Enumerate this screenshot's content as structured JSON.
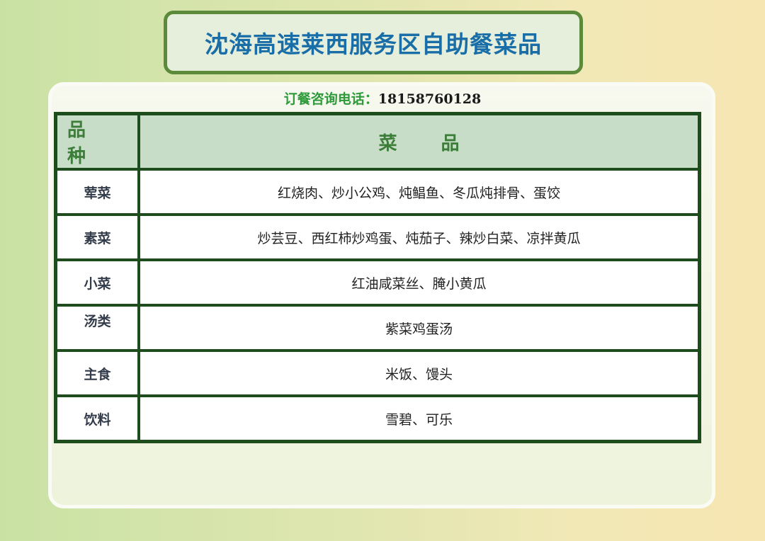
{
  "title": "沈海高速莱西服务区自助餐菜品",
  "phone": {
    "label": "订餐咨询电话：",
    "number": "18158760128"
  },
  "table": {
    "headers": {
      "category": "品种",
      "dishes": "菜品"
    },
    "rows": [
      {
        "category": "荤菜",
        "dishes": "红烧肉、炒小公鸡、炖鲳鱼、冬瓜炖排骨、蛋饺"
      },
      {
        "category": "素菜",
        "dishes": "炒芸豆、西红柿炒鸡蛋、炖茄子、辣炒白菜、凉拌黄瓜"
      },
      {
        "category": "小菜",
        "dishes": "红油咸菜丝、腌小黄瓜"
      },
      {
        "category": "汤类",
        "dishes": "紫菜鸡蛋汤"
      },
      {
        "category": "主食",
        "dishes": "米饭、馒头"
      },
      {
        "category": "饮料",
        "dishes": "雪碧、可乐"
      }
    ]
  }
}
